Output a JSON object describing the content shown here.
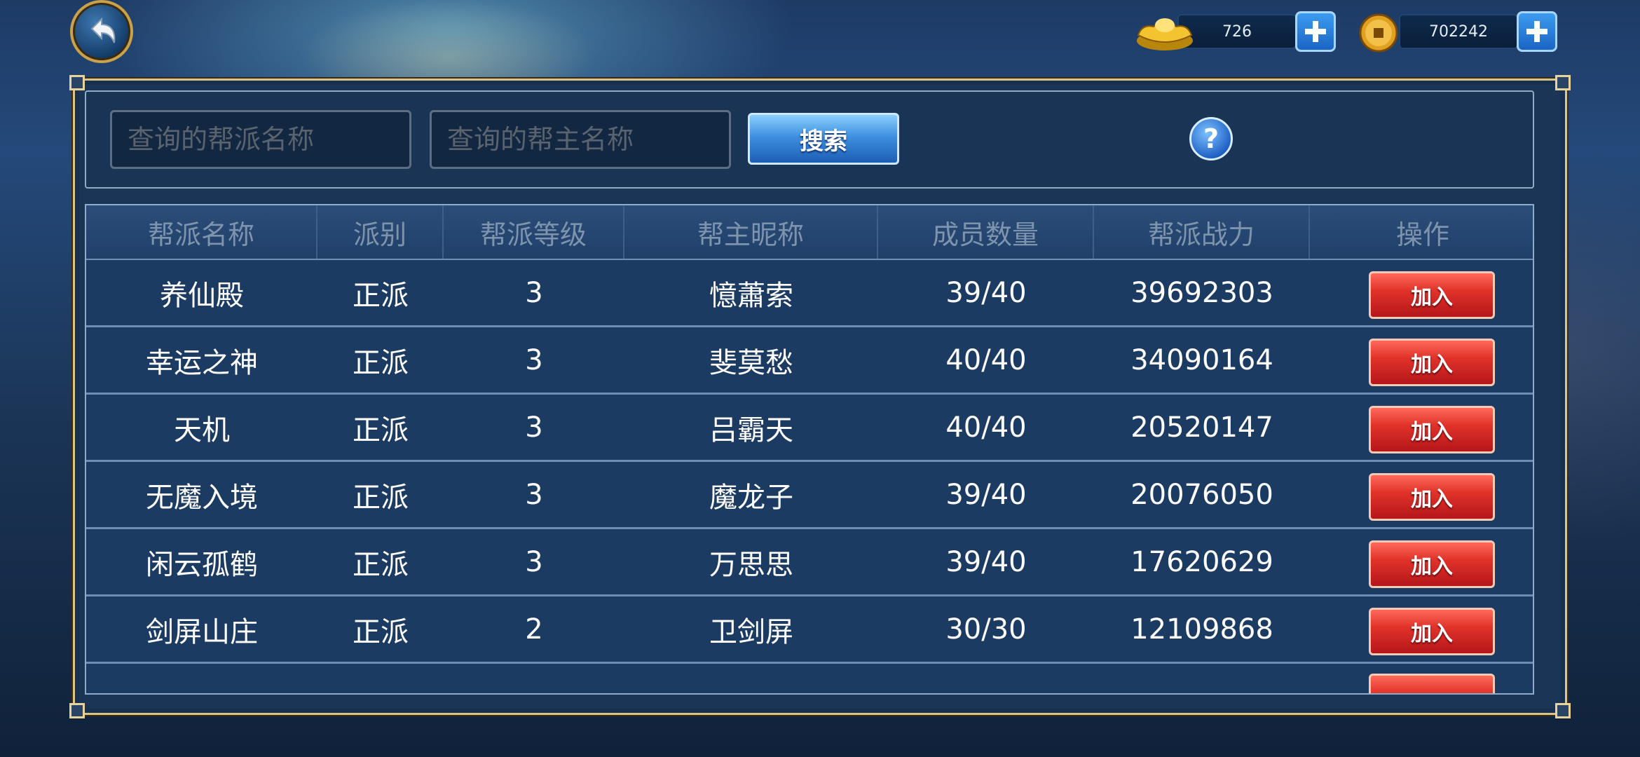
{
  "topbar": {
    "gold_ingot": "726",
    "copper_coin": "702242"
  },
  "search": {
    "guild_name_placeholder": "查询的帮派名称",
    "leader_name_placeholder": "查询的帮主名称",
    "search_label": "搜索",
    "help_label": "?"
  },
  "table": {
    "headers": [
      "帮派名称",
      "派别",
      "帮派等级",
      "帮主昵称",
      "成员数量",
      "帮派战力",
      "操作"
    ],
    "rows": [
      {
        "name": "养仙殿",
        "faction": "正派",
        "level": "3",
        "leader": "憶蕭索",
        "members": "39/40",
        "power": "39692303",
        "action": "加入"
      },
      {
        "name": "幸运之神",
        "faction": "正派",
        "level": "3",
        "leader": "斐莫愁",
        "members": "40/40",
        "power": "34090164",
        "action": "加入"
      },
      {
        "name": "天机",
        "faction": "正派",
        "level": "3",
        "leader": "吕霸天",
        "members": "40/40",
        "power": "20520147",
        "action": "加入"
      },
      {
        "name": "无魔入境",
        "faction": "正派",
        "level": "3",
        "leader": "魔龙子",
        "members": "39/40",
        "power": "20076050",
        "action": "加入"
      },
      {
        "name": "闲云孤鹤",
        "faction": "正派",
        "level": "3",
        "leader": "万思思",
        "members": "39/40",
        "power": "17620629",
        "action": "加入"
      },
      {
        "name": "剑屏山庄",
        "faction": "正派",
        "level": "2",
        "leader": "卫剑屏",
        "members": "30/30",
        "power": "12109868",
        "action": "加入"
      }
    ]
  },
  "colors": {
    "panel_border": "#d9c48a",
    "join_button": "#e0322a",
    "search_button": "#3e8fe0",
    "header_text": "#7e94ad"
  }
}
